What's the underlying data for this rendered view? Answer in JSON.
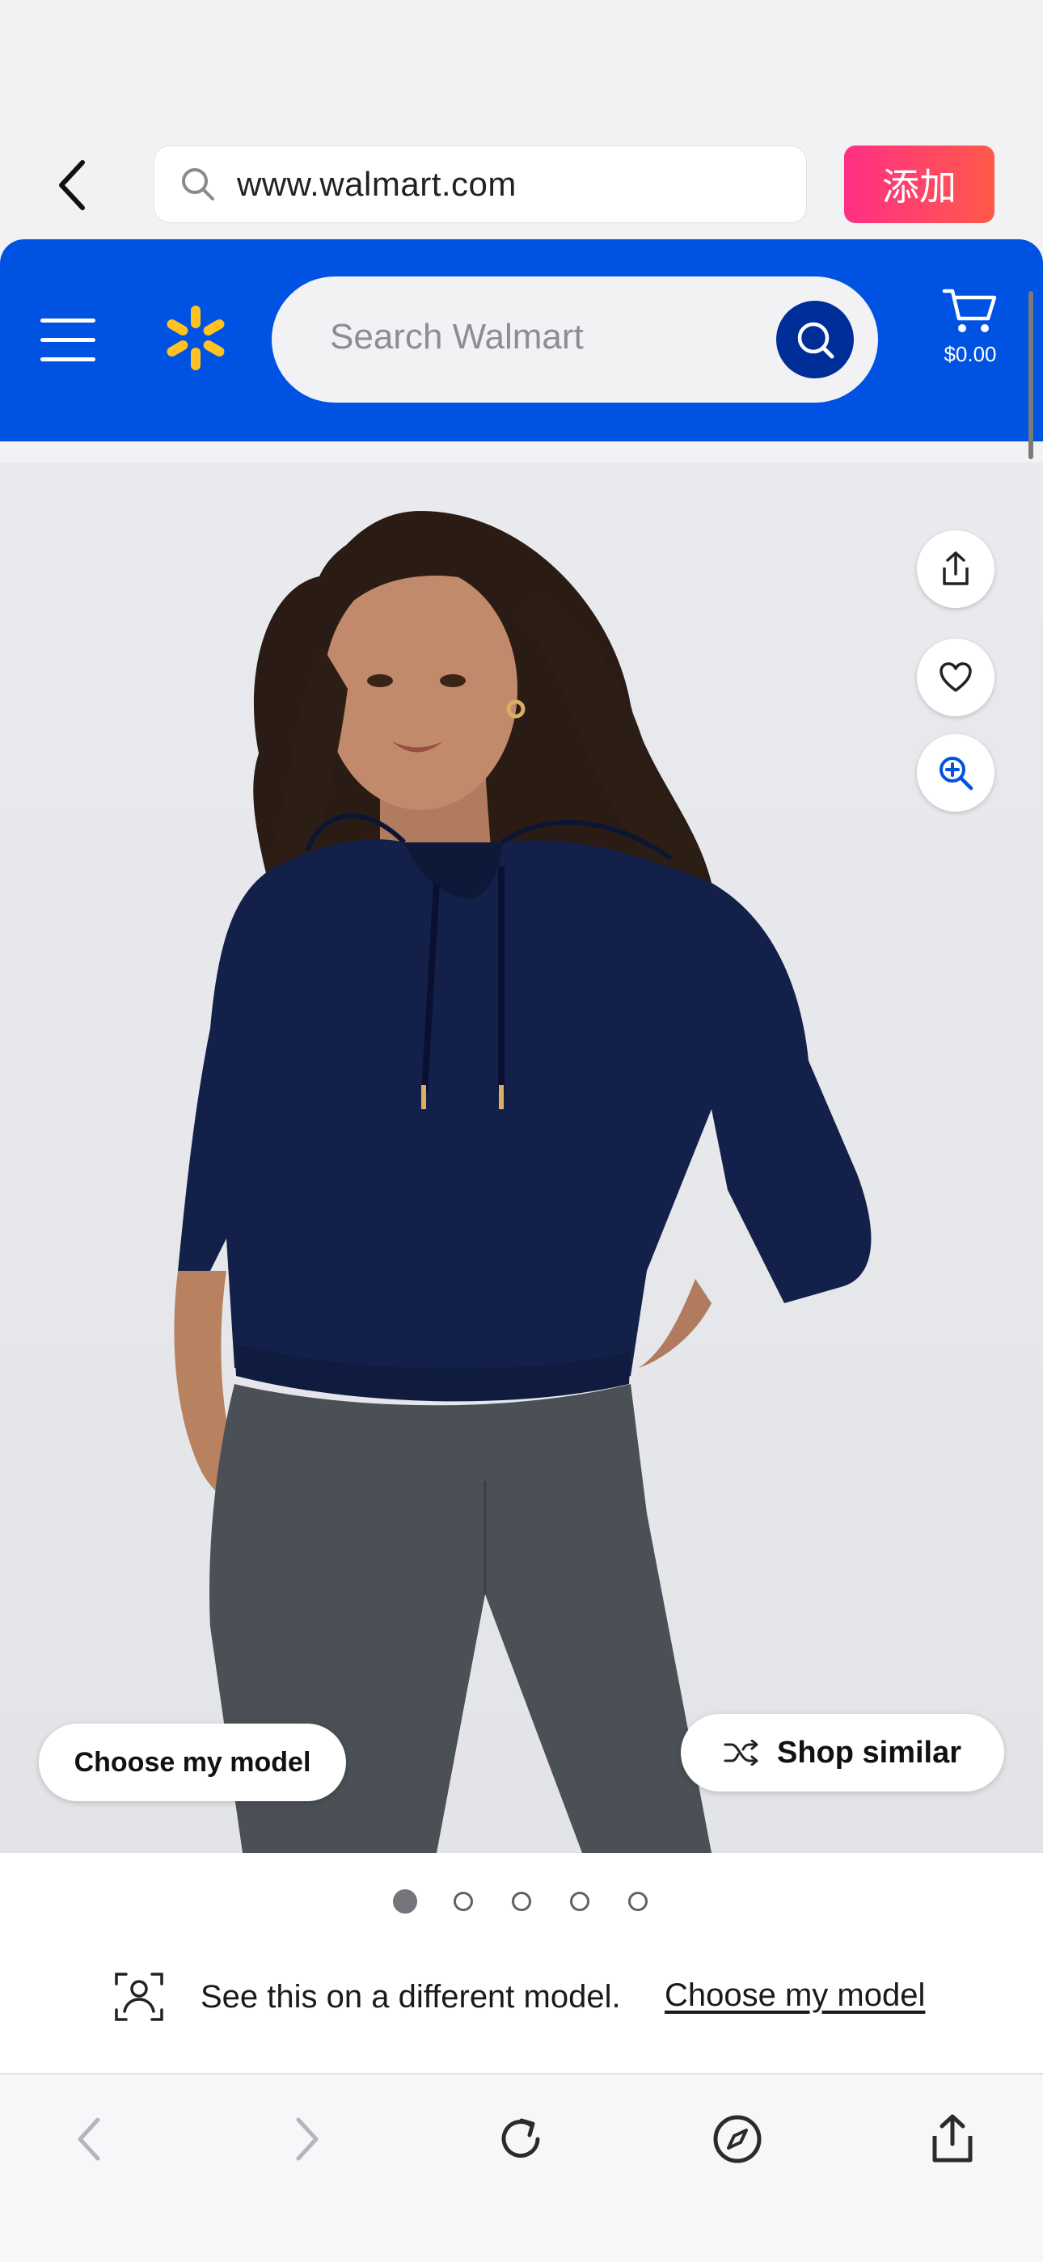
{
  "browser": {
    "url": "www.walmart.com",
    "add_button_label": "添加"
  },
  "header": {
    "search_placeholder": "Search Walmart",
    "cart_amount": "$0.00",
    "brand_color": "#0053e2",
    "spark_color": "#ffc220"
  },
  "product": {
    "image_description_icon": "product-photo-woman-navy-hoodie",
    "choose_model_label": "Choose my model",
    "shop_similar_label": "Shop similar",
    "carousel": {
      "total": 5,
      "active": 1
    }
  },
  "model_banner": {
    "text": "See this on a different model.",
    "link": "Choose my model"
  },
  "toolbar": {
    "items": [
      "back-icon",
      "forward-icon",
      "reload-icon",
      "compass-icon",
      "share-icon"
    ]
  }
}
